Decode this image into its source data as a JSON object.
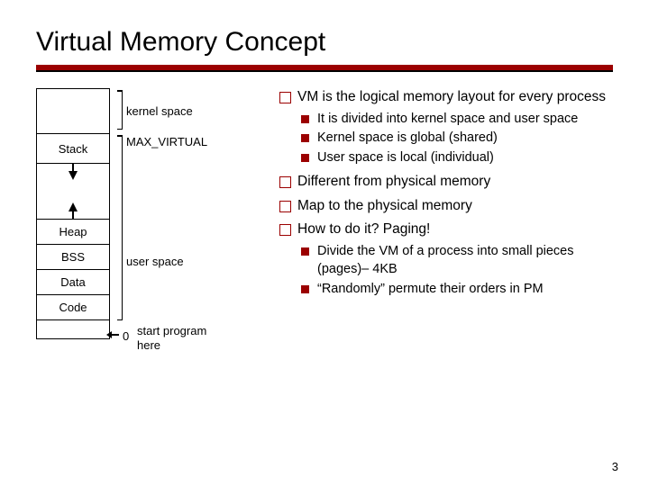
{
  "title": "Virtual Memory Concept",
  "page_number": "3",
  "diagram": {
    "segments": {
      "stack": "Stack",
      "heap": "Heap",
      "bss": "BSS",
      "data": "Data",
      "code": "Code"
    },
    "labels": {
      "kernel_space": "kernel space",
      "max_virtual": "MAX_VIRTUAL",
      "user_space": "user space",
      "zero": "0",
      "start_program": "start program\nhere"
    }
  },
  "bullets": {
    "p1": {
      "text": "VM is the logical memory layout for every process",
      "sub": {
        "s1": "It is divided into kernel space and user space",
        "s2": "Kernel space is global (shared)",
        "s3": "User space is local (individual)"
      }
    },
    "p2": {
      "text": "Different from physical memory"
    },
    "p3": {
      "text": "Map to the physical memory"
    },
    "p4": {
      "text": "How to do it? Paging!",
      "sub": {
        "s1": "Divide the VM of a process into small pieces (pages)– 4KB",
        "s2": "“Randomly” permute their orders in PM"
      }
    }
  }
}
